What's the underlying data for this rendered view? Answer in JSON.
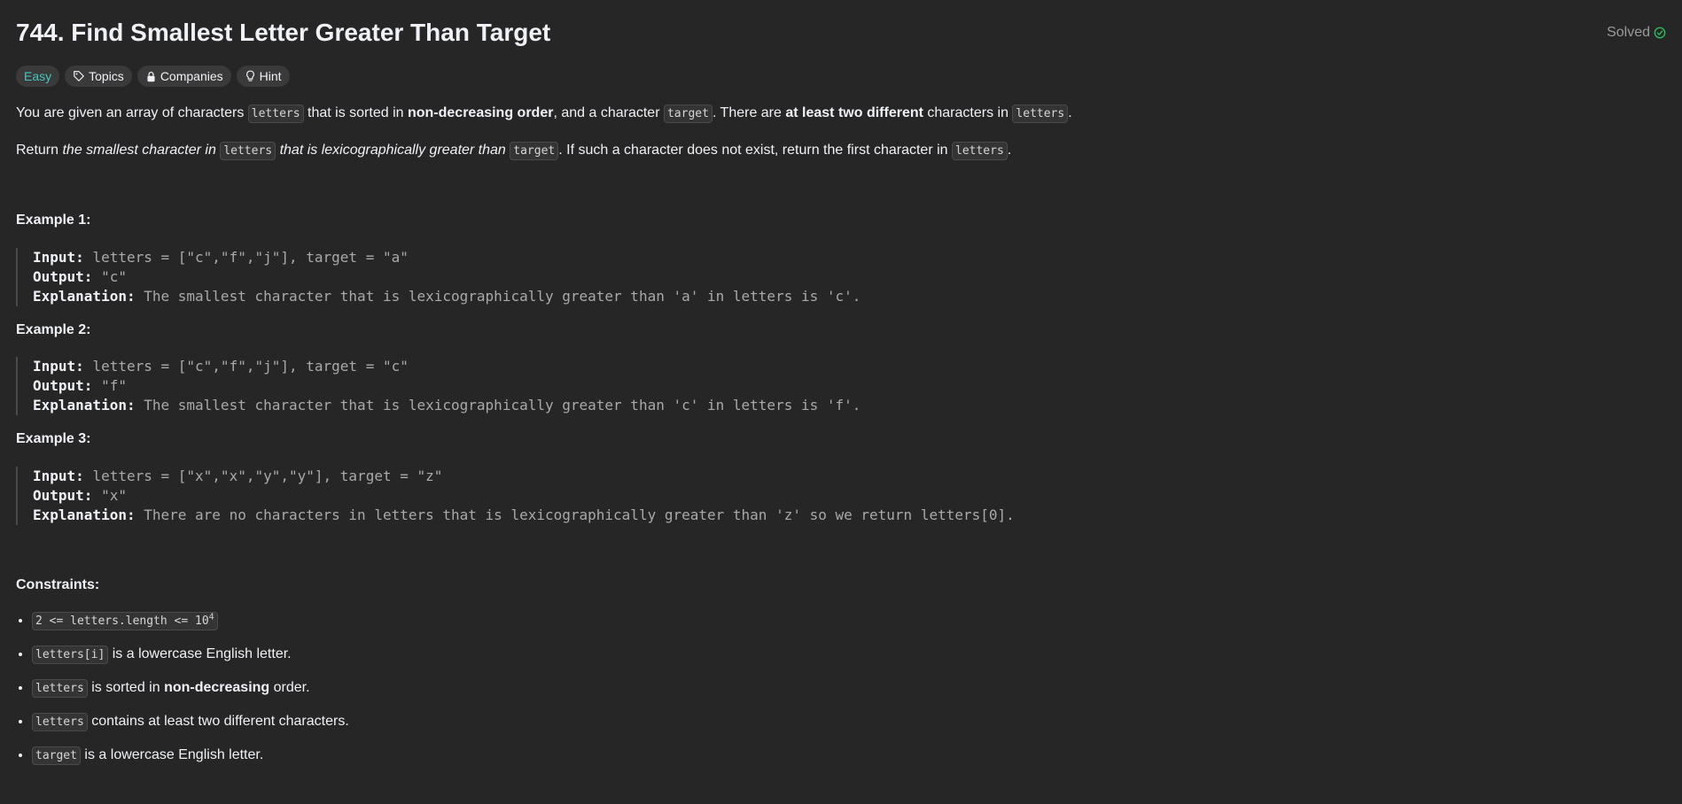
{
  "problem": {
    "title": "744. Find Smallest Letter Greater Than Target",
    "status": "Solved"
  },
  "tags": {
    "difficulty": "Easy",
    "topics": "Topics",
    "companies": "Companies",
    "hint": "Hint"
  },
  "description": {
    "p1": {
      "t1": "You are given an array of characters ",
      "c1": "letters",
      "t2": " that is sorted in ",
      "b1": "non-decreasing order",
      "t3": ", and a character ",
      "c2": "target",
      "t4": ". There are ",
      "b2": "at least two different",
      "t5": " characters in ",
      "c3": "letters",
      "t6": "."
    },
    "p2": {
      "t1": "Return ",
      "i1": "the smallest character in ",
      "c1": "letters",
      "i2": " that is lexicographically greater than ",
      "c2": "target",
      "t2": ". If such a character does not exist, return the first character in ",
      "c3": "letters",
      "t3": "."
    }
  },
  "labels": {
    "input": "Input:",
    "output": "Output:",
    "explanation": "Explanation:"
  },
  "examples": [
    {
      "title": "Example 1:",
      "input": "letters = [\"c\",\"f\",\"j\"], target = \"a\"",
      "output": "\"c\"",
      "explanation": "The smallest character that is lexicographically greater than 'a' in letters is 'c'."
    },
    {
      "title": "Example 2:",
      "input": "letters = [\"c\",\"f\",\"j\"], target = \"c\"",
      "output": "\"f\"",
      "explanation": "The smallest character that is lexicographically greater than 'c' in letters is 'f'."
    },
    {
      "title": "Example 3:",
      "input": "letters = [\"x\",\"x\",\"y\",\"y\"], target = \"z\"",
      "output": "\"x\"",
      "explanation": "There are no characters in letters that is lexicographically greater than 'z' so we return letters[0]."
    }
  ],
  "constraints": {
    "title": "Constraints:",
    "c1": {
      "code": "2 <= letters.length <= 10",
      "sup": "4"
    },
    "c2": {
      "code": "letters[i]",
      "text": " is a lowercase English letter."
    },
    "c3": {
      "code": "letters",
      "t1": " is sorted in ",
      "bold": "non-decreasing",
      "t2": " order."
    },
    "c4": {
      "code": "letters",
      "text": " contains at least two different characters."
    },
    "c5": {
      "code": "target",
      "text": " is a lowercase English letter."
    }
  },
  "colors": {
    "background": "#262626",
    "easy": "#46c6c2",
    "solved_check": "#2cbb5d"
  },
  "icons": [
    "check-circle-icon",
    "tag-icon",
    "lock-icon",
    "lightbulb-icon"
  ]
}
